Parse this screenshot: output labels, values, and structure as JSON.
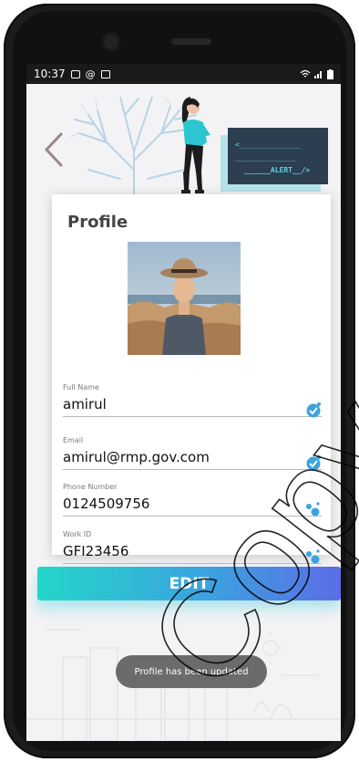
{
  "status_bar": {
    "time": "10:37"
  },
  "header": {
    "alert_line1": "<______________",
    "alert_line2": "______________",
    "alert_line3": "______ALERT__/>"
  },
  "profile": {
    "title": "Profile",
    "fields": [
      {
        "label": "Full Name",
        "value": "amirul",
        "icon": "verified-check-icon"
      },
      {
        "label": "Email",
        "value": "amirul@rmp.gov.com",
        "icon": "verified-check-icon"
      },
      {
        "label": "Phone Number",
        "value": "0124509756",
        "icon": "dots-icon"
      },
      {
        "label": "Work ID",
        "value": "GFI23456",
        "icon": "dots-icon"
      }
    ]
  },
  "actions": {
    "edit_label": "EDIT"
  },
  "toast": {
    "message": "Profile has been updated"
  },
  "watermark": {
    "text": "Copyright"
  },
  "colors": {
    "accent_start": "#24d6c9",
    "accent_end": "#5b6ee6",
    "check": "#3ba3e0"
  }
}
